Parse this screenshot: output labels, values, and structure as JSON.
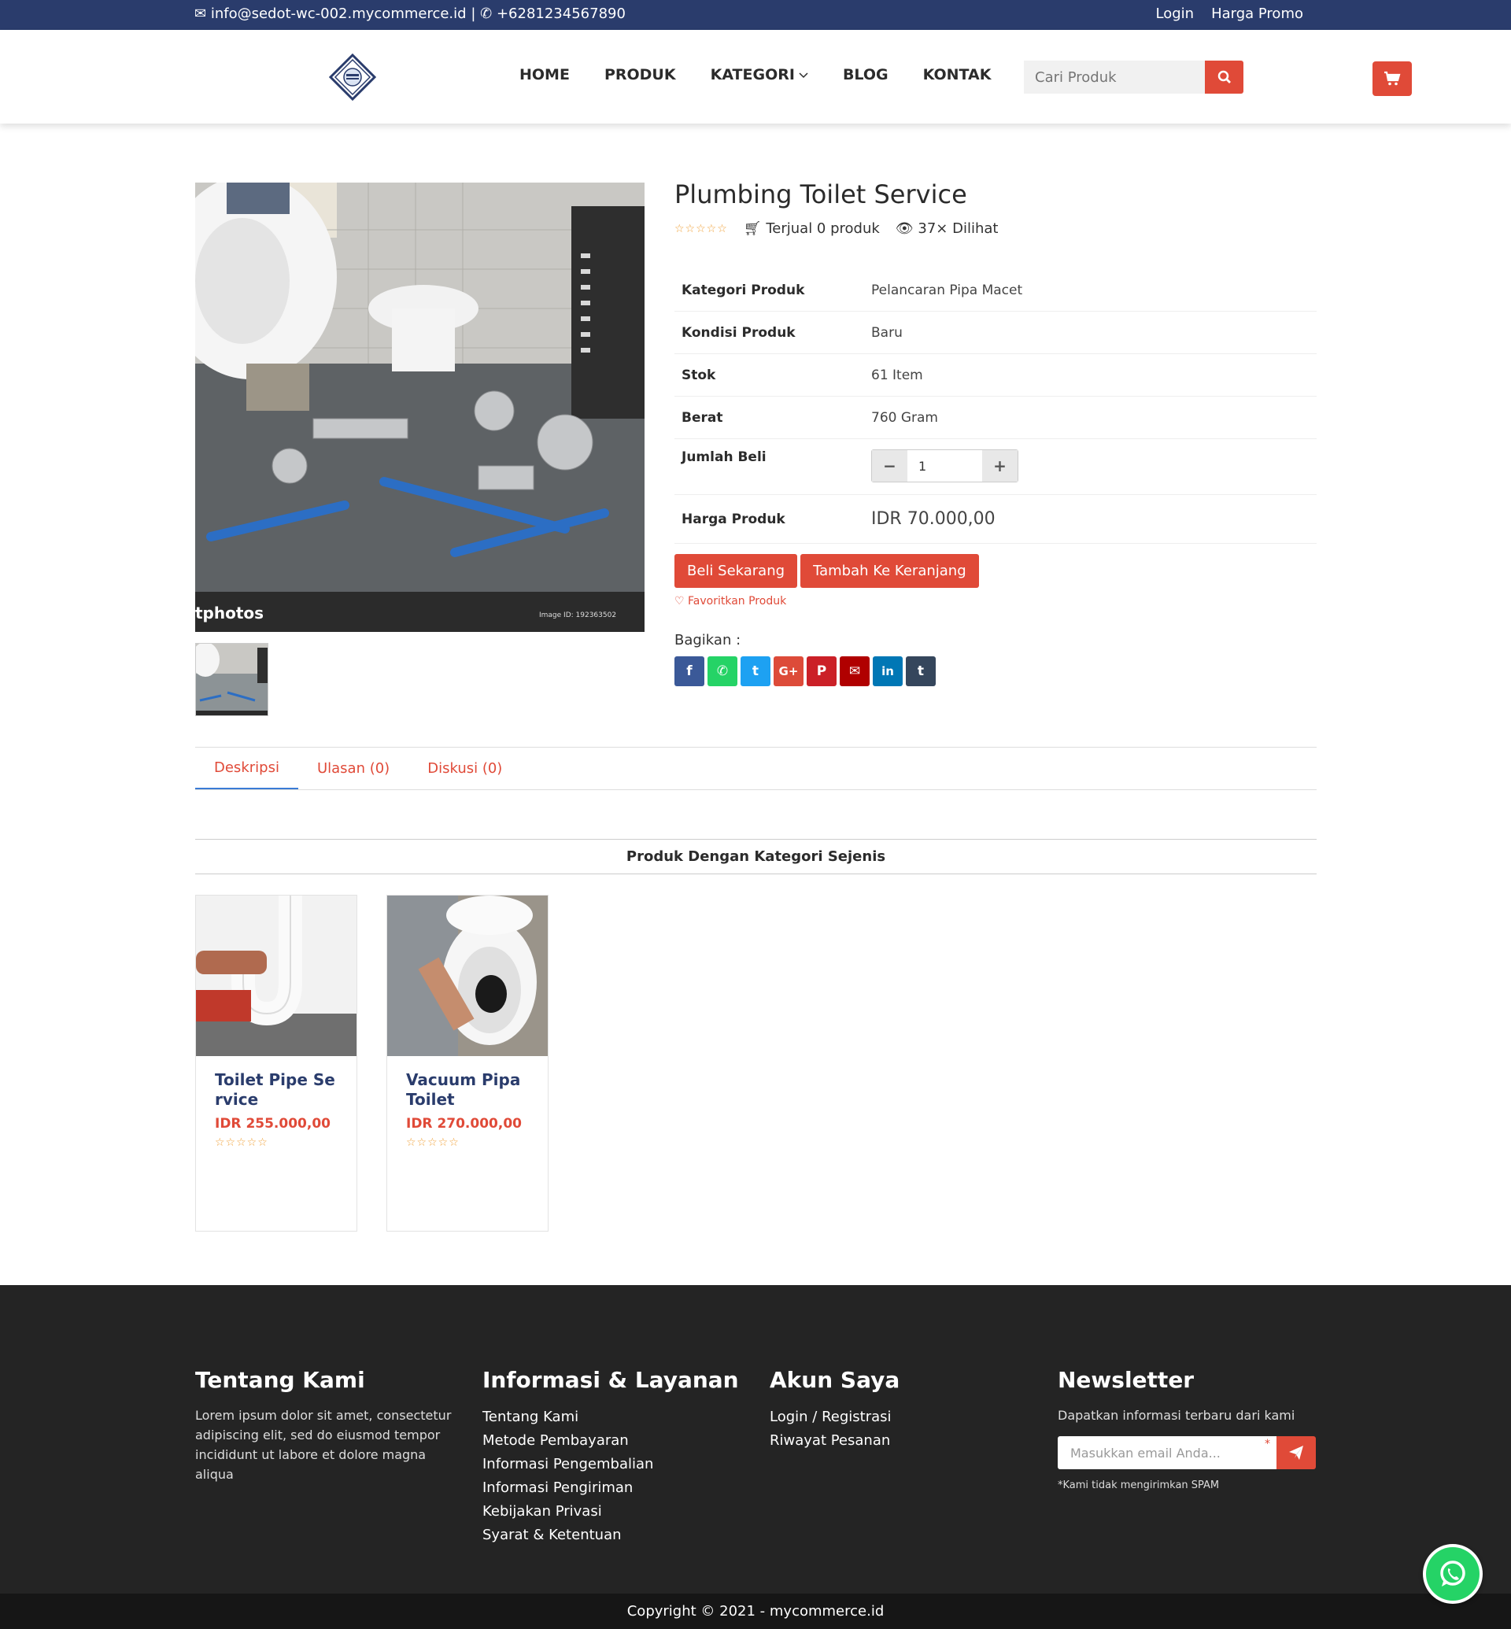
{
  "topbar": {
    "email": "info@sedot-wc-002.mycommerce.id",
    "separator": "|",
    "phone": "+6281234567890",
    "login": "Login",
    "promo": "Harga Promo"
  },
  "nav": {
    "items": [
      "HOME",
      "PRODUK",
      "KATEGORI",
      "BLOG",
      "KONTAK"
    ]
  },
  "search": {
    "placeholder": "Cari Produk"
  },
  "product": {
    "title": "Plumbing Toilet Service",
    "rating_stars": "☆☆☆☆☆",
    "sold": "Terjual 0 produk",
    "views": "37× Dilihat",
    "specs": [
      {
        "label": "Kategori Produk",
        "value": "Pelancaran Pipa Macet"
      },
      {
        "label": "Kondisi Produk",
        "value": "Baru"
      },
      {
        "label": "Stok",
        "value": "61 Item"
      },
      {
        "label": "Berat",
        "value": "760 Gram"
      }
    ],
    "qty_label": "Jumlah Beli",
    "qty_value": "1",
    "price_label": "Harga Produk",
    "price": "IDR 70.000,00",
    "buy_now": "Beli Sekarang",
    "add_cart": "Tambah Ke Keranjang",
    "favorite": "Favoritkan Produk",
    "share_label": "Bagikan :",
    "image_watermark": "tphotos",
    "image_id": "Image ID: 192363502"
  },
  "share_buttons": [
    {
      "name": "facebook",
      "glyph": "f",
      "color": "#3b5998"
    },
    {
      "name": "whatsapp",
      "glyph": "✆",
      "color": "#25d366"
    },
    {
      "name": "twitter",
      "glyph": "t",
      "color": "#1da1f2"
    },
    {
      "name": "google-plus",
      "glyph": "G+",
      "color": "#dd4b39"
    },
    {
      "name": "pinterest",
      "glyph": "P",
      "color": "#cb2027"
    },
    {
      "name": "email",
      "glyph": "✉",
      "color": "#b00000"
    },
    {
      "name": "linkedin",
      "glyph": "in",
      "color": "#0077b5"
    },
    {
      "name": "tumblr",
      "glyph": "t",
      "color": "#35465c"
    }
  ],
  "tabs": [
    "Deskripsi",
    "Ulasan (0)",
    "Diskusi (0)"
  ],
  "related": {
    "title": "Produk Dengan Kategori Sejenis",
    "items": [
      {
        "name": "Toilet Pipe Service",
        "price": "IDR 255.000,00",
        "stars": "☆☆☆☆☆"
      },
      {
        "name": "Vacuum Pipa Toilet",
        "price": "IDR 270.000,00",
        "stars": "☆☆☆☆☆"
      }
    ]
  },
  "footer": {
    "about_title": "Tentang Kami",
    "about_text": "Lorem ipsum dolor sit amet, consectetur adipiscing elit, sed do eiusmod tempor incididunt ut labore et dolore magna aliqua",
    "info_title": "Informasi & Layanan",
    "info_links": [
      "Tentang Kami",
      "Metode Pembayaran",
      "Informasi Pengembalian",
      "Informasi Pengiriman",
      "Kebijakan Privasi",
      "Syarat & Ketentuan"
    ],
    "account_title": "Akun Saya",
    "account_links": [
      "Login / Registrasi",
      "Riwayat Pesanan"
    ],
    "newsletter_title": "Newsletter",
    "newsletter_text": "Dapatkan informasi terbaru dari kami",
    "newsletter_placeholder": "Masukkan email Anda...",
    "newsletter_required": "*",
    "newsletter_note": "*Kami tidak mengirimkan SPAM",
    "copyright": "Copyright © 2021 - mycommerce.id"
  },
  "colors": {
    "accent": "#e04a38",
    "topbar": "#2a3c6c",
    "footer": "#242424"
  }
}
